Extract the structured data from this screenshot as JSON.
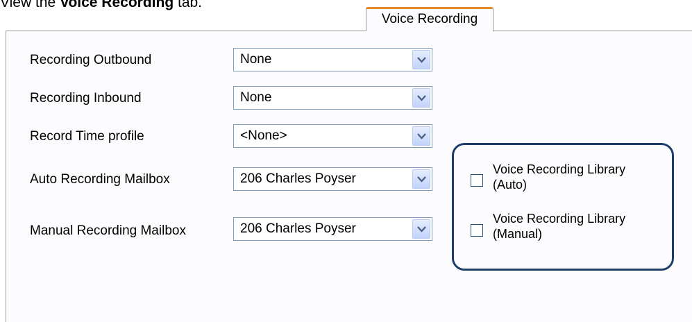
{
  "instruction": {
    "prefix": "View the ",
    "emphasis": "Voice Recording",
    "suffix": " tab."
  },
  "tab": {
    "label": "Voice Recording"
  },
  "form": {
    "recording_outbound": {
      "label": "Recording Outbound",
      "value": "None"
    },
    "recording_inbound": {
      "label": "Recording Inbound",
      "value": "None"
    },
    "record_time_profile": {
      "label": "Record Time profile",
      "value": "<None>"
    },
    "auto_recording_mailbox": {
      "label": "Auto Recording Mailbox",
      "value": "206 Charles Poyser"
    },
    "manual_recording_mailbox": {
      "label": "Manual Recording Mailbox",
      "value": "206 Charles Poyser"
    }
  },
  "library": {
    "auto": {
      "line1": "Voice Recording Library",
      "line2": "(Auto)",
      "checked": false
    },
    "manual": {
      "line1": "Voice Recording Library",
      "line2": "(Manual)",
      "checked": false
    }
  },
  "colors": {
    "tab_accent": "#e68b2c",
    "group_border": "#1d3d6b",
    "combo_border": "#7f9db9"
  },
  "icons": {
    "dropdown": "chevron-down-icon"
  }
}
